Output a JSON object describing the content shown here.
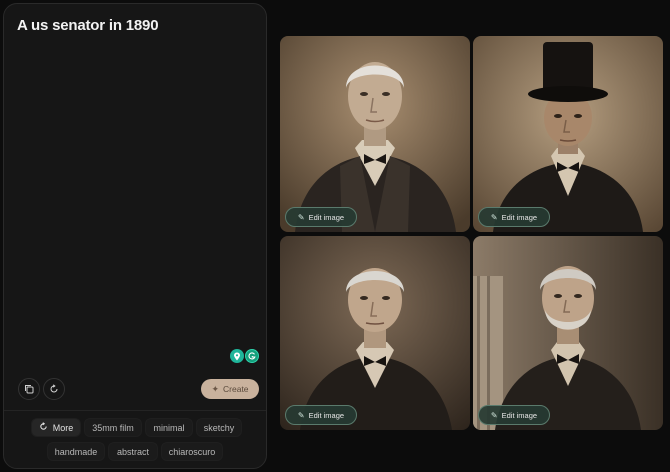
{
  "prompt": "A us senator in 1890",
  "actions": {
    "create_label": "Create"
  },
  "suggestions": {
    "more_label": "More",
    "chips": [
      "35mm film",
      "minimal",
      "sketchy",
      "handmade",
      "abstract",
      "chiaroscuro"
    ]
  },
  "images": [
    {
      "edit_label": "Edit image"
    },
    {
      "edit_label": "Edit image"
    },
    {
      "edit_label": "Edit image"
    },
    {
      "edit_label": "Edit image"
    }
  ],
  "colors": {
    "background": "#0c0c0c",
    "panel": "#161616",
    "create_button": "#c9b29d",
    "edit_button": "#263a32",
    "extension_teal": "#1fb59a"
  }
}
